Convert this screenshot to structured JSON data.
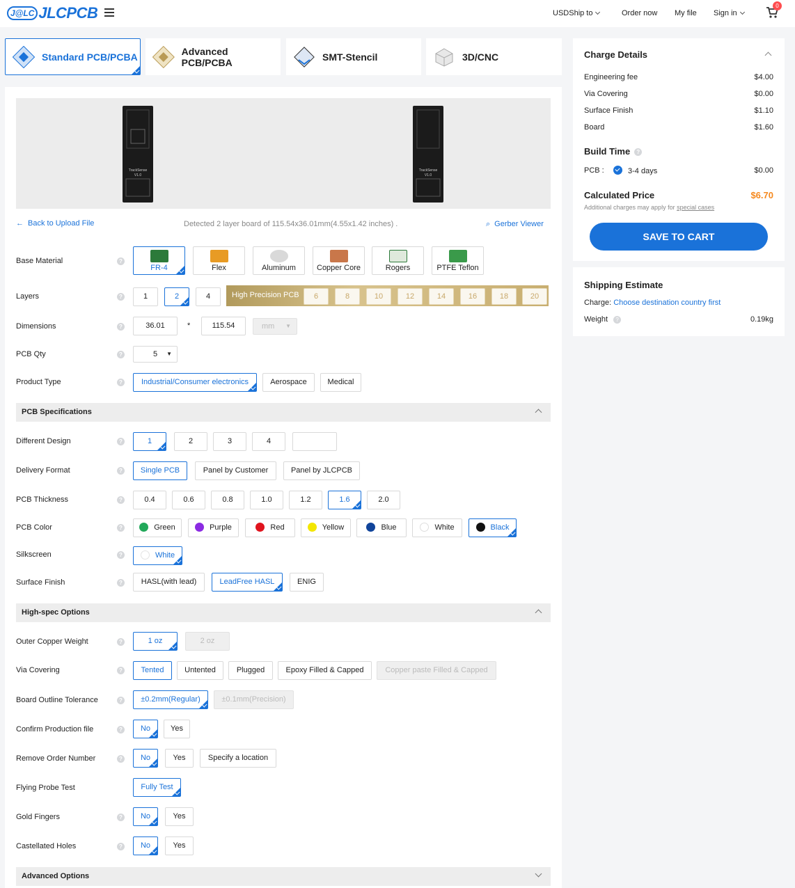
{
  "nav": {
    "logo_badge": "J@LC",
    "logo_word": "JLCPCB",
    "currency": "USD",
    "ship_to": "Ship to",
    "order_now": "Order now",
    "my_file": "My file",
    "sign_in": "Sign in",
    "cart_count": "0"
  },
  "product_tabs": [
    {
      "label": "Standard PCB/PCBA",
      "active": true
    },
    {
      "label": "Advanced PCB/PCBA",
      "active": false
    },
    {
      "label": "SMT-Stencil",
      "active": false
    },
    {
      "label": "3D/CNC",
      "active": false
    }
  ],
  "preview": {
    "board_text_1": "TrackSense",
    "board_text_2": "V1.0",
    "back_link": "Back to Upload File",
    "detected": "Detected 2 layer board of 115.54x36.01mm(4.55x1.42 inches) .",
    "gerber": "Gerber Viewer"
  },
  "form": {
    "base_material": {
      "label": "Base Material",
      "options": [
        "FR-4",
        "Flex",
        "Aluminum",
        "Copper Core",
        "Rogers",
        "PTFE Teflon"
      ],
      "selected": "FR-4"
    },
    "layers": {
      "label": "Layers",
      "options": [
        "1",
        "2",
        "4"
      ],
      "selected": "2",
      "high_precision_label": "High Precision PCB",
      "high_precision_options": [
        "6",
        "8",
        "10",
        "12",
        "14",
        "16",
        "18",
        "20"
      ]
    },
    "dimensions": {
      "label": "Dimensions",
      "width": "36.01",
      "times": "*",
      "height": "115.54",
      "unit": "mm"
    },
    "pcb_qty": {
      "label": "PCB Qty",
      "value": "5"
    },
    "product_type": {
      "label": "Product Type",
      "options": [
        "Industrial/Consumer electronics",
        "Aerospace",
        "Medical"
      ],
      "selected": "Industrial/Consumer electronics"
    },
    "pcb_spec_title": "PCB Specifications",
    "different_design": {
      "label": "Different Design",
      "options": [
        "1",
        "2",
        "3",
        "4"
      ],
      "selected": "1"
    },
    "delivery_format": {
      "label": "Delivery Format",
      "options": [
        "Single PCB",
        "Panel by Customer",
        "Panel by JLCPCB"
      ],
      "selected": "Single PCB"
    },
    "pcb_thickness": {
      "label": "PCB Thickness",
      "options": [
        "0.4",
        "0.6",
        "0.8",
        "1.0",
        "1.2",
        "1.6",
        "2.0"
      ],
      "selected": "1.6"
    },
    "pcb_color": {
      "label": "PCB Color",
      "options": [
        {
          "name": "Green",
          "color": "#22a85a"
        },
        {
          "name": "Purple",
          "color": "#8b2be2"
        },
        {
          "name": "Red",
          "color": "#e0141e"
        },
        {
          "name": "Yellow",
          "color": "#f3e600"
        },
        {
          "name": "Blue",
          "color": "#10449a"
        },
        {
          "name": "White",
          "color": "#ffffff"
        },
        {
          "name": "Black",
          "color": "#111111"
        }
      ],
      "selected": "Black"
    },
    "silkscreen": {
      "label": "Silkscreen",
      "value": "White"
    },
    "surface_finish": {
      "label": "Surface Finish",
      "options": [
        "HASL(with lead)",
        "LeadFree HASL",
        "ENIG"
      ],
      "selected": "LeadFree HASL"
    },
    "high_spec_title": "High-spec Options",
    "outer_copper": {
      "label": "Outer Copper Weight",
      "options": [
        "1 oz",
        "2 oz"
      ],
      "selected": "1 oz"
    },
    "via_covering": {
      "label": "Via Covering",
      "options": [
        "Tented",
        "Untented",
        "Plugged",
        "Epoxy Filled & Capped",
        "Copper paste Filled & Capped"
      ],
      "selected": "Tented"
    },
    "outline_tolerance": {
      "label": "Board Outline Tolerance",
      "options": [
        "±0.2mm(Regular)",
        "±0.1mm(Precision)"
      ],
      "selected": "±0.2mm(Regular)"
    },
    "confirm_production": {
      "label": "Confirm Production file",
      "options": [
        "No",
        "Yes"
      ],
      "selected": "No"
    },
    "remove_order_number": {
      "label": "Remove Order Number",
      "options": [
        "No",
        "Yes",
        "Specify a location"
      ],
      "selected": "No"
    },
    "flying_probe": {
      "label": "Flying Probe Test",
      "value": "Fully Test"
    },
    "gold_fingers": {
      "label": "Gold Fingers",
      "options": [
        "No",
        "Yes"
      ],
      "selected": "No"
    },
    "castellated": {
      "label": "Castellated Holes",
      "options": [
        "No",
        "Yes"
      ],
      "selected": "No"
    },
    "advanced_title": "Advanced Options"
  },
  "charge": {
    "title": "Charge Details",
    "lines": [
      {
        "label": "Engineering fee",
        "value": "$4.00"
      },
      {
        "label": "Via Covering",
        "value": "$0.00"
      },
      {
        "label": "Surface Finish",
        "value": "$1.10"
      },
      {
        "label": "Board",
        "value": "$1.60"
      }
    ],
    "build_time_title": "Build Time",
    "build_pcb_label": "PCB :",
    "build_days": "3-4 days",
    "build_value": "$0.00",
    "calc_title": "Calculated Price",
    "calc_value": "$6.70",
    "calc_note": "Additional charges may apply for",
    "calc_note_link": "special cases",
    "save_button": "SAVE TO CART"
  },
  "shipping": {
    "title": "Shipping Estimate",
    "charge_label": "Charge:",
    "charge_link": "Choose destination country first",
    "weight_label": "Weight",
    "weight_value": "0.19kg"
  }
}
